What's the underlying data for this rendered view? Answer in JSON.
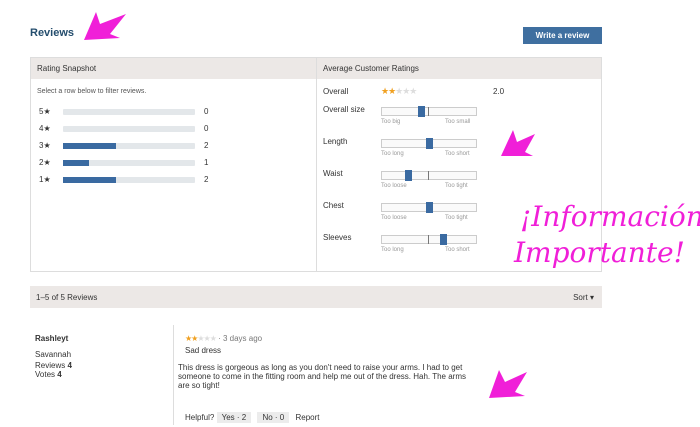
{
  "header": {
    "title": "Reviews",
    "write_label": "Write a review"
  },
  "snapshot": {
    "heading": "Rating Snapshot",
    "hint": "Select a row below to filter reviews.",
    "rows": [
      {
        "label": "5★",
        "count": "0",
        "fraction": 0
      },
      {
        "label": "4★",
        "count": "0",
        "fraction": 0
      },
      {
        "label": "3★",
        "count": "2",
        "fraction": 0.4
      },
      {
        "label": "2★",
        "count": "1",
        "fraction": 0.2
      },
      {
        "label": "1★",
        "count": "2",
        "fraction": 0.4
      }
    ]
  },
  "averages": {
    "heading": "Average Customer Ratings",
    "overall_label": "Overall",
    "overall_value": "2.0",
    "overall_stars": 2,
    "attributes": [
      {
        "label": "Overall size",
        "low": "Too big",
        "high": "Too small",
        "position": 0.42
      },
      {
        "label": "Length",
        "low": "Too long",
        "high": "Too short",
        "position": 0.5
      },
      {
        "label": "Waist",
        "low": "Too loose",
        "high": "Too tight",
        "position": 0.28
      },
      {
        "label": "Chest",
        "low": "Too loose",
        "high": "Too tight",
        "position": 0.5
      },
      {
        "label": "Sleeves",
        "low": "Too long",
        "high": "Too short",
        "position": 0.65
      }
    ]
  },
  "list": {
    "count_label": "1–5 of 5 Reviews",
    "sort_label": "Sort ▾"
  },
  "review": {
    "author": "Rashleyt",
    "location": "Savannah",
    "reviews_label": "Reviews",
    "reviews_count": "4",
    "votes_label": "Votes",
    "votes_count": "4",
    "stars": 2,
    "age": "· 3 days ago",
    "title": "Sad dress",
    "body": "This dress is gorgeous as long as you don't need to raise your arms. I had to get someone to come in the fitting room and help me out of the dress. Hah. The arms are so tight!",
    "helpful_label": "Helpful?",
    "yes_label": "Yes · 2",
    "no_label": "No · 0",
    "report_label": "Report"
  },
  "annotation": {
    "line1": "¡Información",
    "line2": "Importante!"
  },
  "colors": {
    "accent": "#3a6aa1",
    "title": "#244d6d",
    "annotation": "#f01fd8",
    "star": "#f0a020"
  }
}
